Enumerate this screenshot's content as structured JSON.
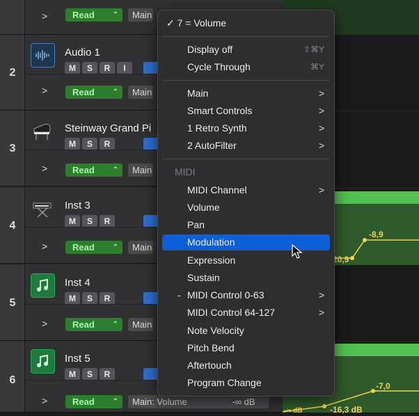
{
  "tracks": [
    {
      "number": "",
      "name": "",
      "automation_mode": "Read",
      "automation_param": "Main",
      "value": ""
    },
    {
      "number": "2",
      "name": "Audio 1",
      "buttons": [
        "M",
        "S",
        "R",
        "I"
      ],
      "automation_mode": "Read",
      "automation_param": "Main"
    },
    {
      "number": "3",
      "name": "Steinway Grand Pi",
      "buttons": [
        "M",
        "S",
        "R"
      ],
      "automation_mode": "Read",
      "automation_param": "Main"
    },
    {
      "number": "4",
      "name": "Inst 3",
      "buttons": [
        "M",
        "S",
        "R"
      ],
      "automation_mode": "Read",
      "automation_param": "Main"
    },
    {
      "number": "5",
      "name": "Inst 4",
      "buttons": [
        "M",
        "S",
        "R"
      ],
      "automation_mode": "Read",
      "automation_param": "Main"
    },
    {
      "number": "6",
      "name": "Inst 5",
      "buttons": [
        "M",
        "S",
        "R"
      ],
      "automation_mode": "Read",
      "automation_param": "Main: Volume",
      "value": "-∞ dB"
    }
  ],
  "automation_values": {
    "lane4_high": "-8,9",
    "lane4_low": "20,9",
    "lane6_high": "-7,0",
    "lane6_low": "-16,3 dB",
    "lane6_left": "-∞ dB"
  },
  "menu": {
    "current": "✓ 7 = Volume",
    "display_off": {
      "label": "Display off",
      "shortcut": "⇧⌘Y"
    },
    "cycle_through": {
      "label": "Cycle Through",
      "shortcut": "⌘Y"
    },
    "groups": [
      "Main",
      "Smart Controls",
      "1 Retro Synth",
      "2 AutoFilter"
    ],
    "midi_header": "MIDI",
    "midi_items": [
      {
        "label": "MIDI Channel",
        "submenu": true
      },
      {
        "label": "Volume"
      },
      {
        "label": "Pan"
      },
      {
        "label": "Modulation",
        "highlighted": true
      },
      {
        "label": "Expression"
      },
      {
        "label": "Sustain"
      },
      {
        "label": "MIDI Control 0-63",
        "submenu": true,
        "prefix": "-"
      },
      {
        "label": "MIDI Control 64-127",
        "submenu": true
      },
      {
        "label": "Note Velocity"
      },
      {
        "label": "Pitch Bend"
      },
      {
        "label": "Aftertouch"
      },
      {
        "label": "Program Change"
      }
    ],
    "submenu_glyph": ">"
  },
  "colors": {
    "highlight": "#0b5fd9",
    "read_green": "#2f7d2f",
    "automation_yellow": "#f2d54a",
    "region_green": "#52c152"
  }
}
